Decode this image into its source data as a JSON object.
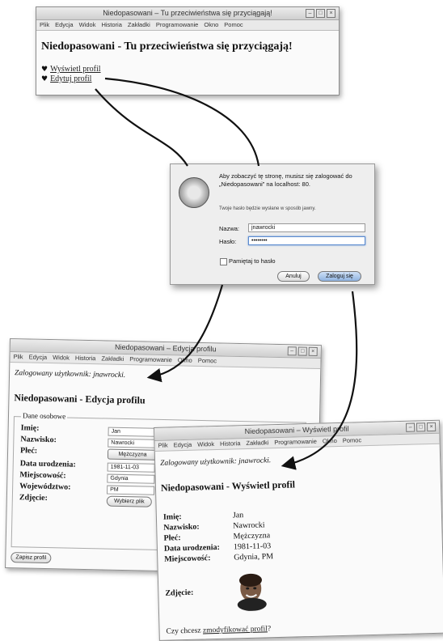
{
  "menu": [
    "Plik",
    "Edycja",
    "Widok",
    "Historia",
    "Zakładki",
    "Programowanie",
    "Okno",
    "Pomoc"
  ],
  "win1": {
    "title": "Niedopasowani – Tu przeciwieństwa się przyciągają!",
    "heading": "Niedopasowani - Tu przeciwieństwa się przyciągają!",
    "link1": "Wyświetl profil",
    "link2": "Edytuj profil"
  },
  "dialog": {
    "message": "Aby zobaczyć tę stronę, musisz się zalogować do „Niedopasowani” na localhost: 80.",
    "warning": "Twoje hasło będzie wysłane w sposób jawny.",
    "name_label": "Nazwa:",
    "name_value": "jnawrocki",
    "pass_label": "Hasło:",
    "pass_value": "••••••••",
    "remember": "Pamiętaj to hasło",
    "cancel": "Anuluj",
    "login": "Zaloguj się"
  },
  "win3": {
    "title": "Niedopasowani – Edycja profilu",
    "logged": "Zalogowany użytkownik: jnawrocki.",
    "heading": "Niedopasowani - Edycja profilu",
    "fieldset": "Dane osobowe",
    "fields": [
      {
        "label": "Imię:",
        "value": "Jan"
      },
      {
        "label": "Nazwisko:",
        "value": "Nawrocki"
      },
      {
        "label": "Płeć:",
        "value": "Mężczyzna"
      },
      {
        "label": "Data urodzenia:",
        "value": "1981-11-03"
      },
      {
        "label": "Miejscowość:",
        "value": "Gdynia"
      },
      {
        "label": "Województwo:",
        "value": "PM"
      },
      {
        "label": "Zdjęcie:",
        "value": "Wybierz plik"
      }
    ],
    "save": "Zapisz profil"
  },
  "win4": {
    "title": "Niedopasowani – Wyświetl profil",
    "logged": "Zalogowany użytkownik: jnawrocki.",
    "heading": "Niedopasowani - Wyświetl profil",
    "rows": [
      {
        "label": "Imię:",
        "value": "Jan"
      },
      {
        "label": "Nazwisko:",
        "value": "Nawrocki"
      },
      {
        "label": "Płeć:",
        "value": "Mężczyzna"
      },
      {
        "label": "Data urodzenia:",
        "value": "1981-11-03"
      },
      {
        "label": "Miejscowość:",
        "value": "Gdynia, PM"
      }
    ],
    "photo_label": "Zdjęcie:",
    "question_pre": "Czy chcesz ",
    "question_link": "zmodyfikować profil",
    "question_post": "?"
  }
}
